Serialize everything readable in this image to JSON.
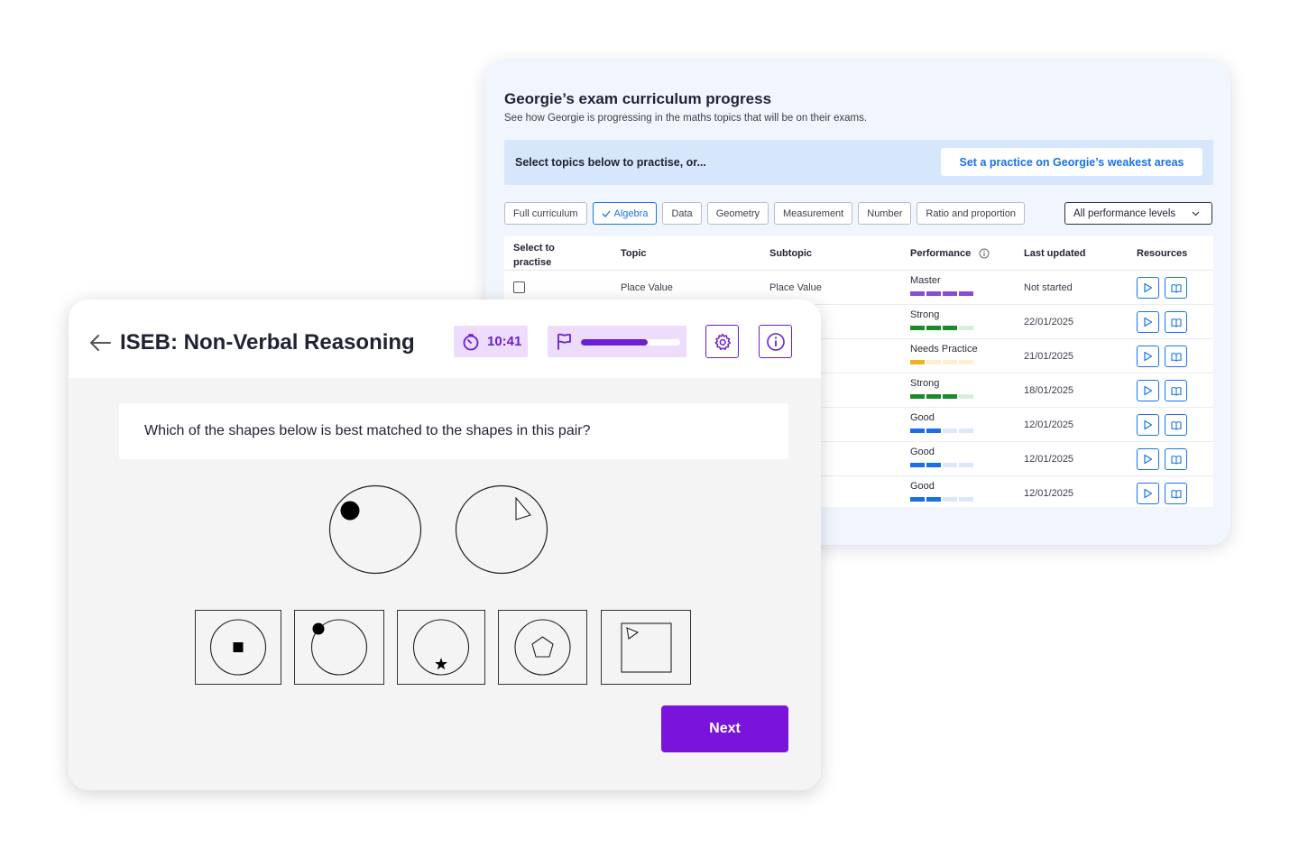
{
  "progress": {
    "title": "Georgie’s exam curriculum progress",
    "subtitle": "See how Georgie is progressing in the maths topics that will be on their exams.",
    "banner_text": "Select topics below to practise, or...",
    "banner_button": "Set a practice on Georgie’s weakest areas",
    "filters": [
      "Full curriculum",
      "Algebra",
      "Data",
      "Geometry",
      "Measurement",
      "Number",
      "Ratio and proportion"
    ],
    "active_filter": "Algebra",
    "performance_select": "All performance levels",
    "columns": {
      "select": "Select to practise",
      "topic": "Topic",
      "subtopic": "Subtopic",
      "performance": "Performance",
      "updated": "Last updated",
      "resources": "Resources"
    },
    "rows": [
      {
        "topic": "Place Value",
        "subtopic": "Place Value",
        "performance": "Master",
        "level": 4,
        "scheme": "purple",
        "updated": "Not started"
      },
      {
        "topic": "",
        "subtopic": "",
        "performance": "Strong",
        "level": 3,
        "scheme": "green",
        "updated": "22/01/2025"
      },
      {
        "topic": "",
        "subtopic": "",
        "performance": "Needs Practice",
        "level": 1,
        "scheme": "orange",
        "updated": "21/01/2025"
      },
      {
        "topic": "",
        "subtopic": "",
        "performance": "Strong",
        "level": 3,
        "scheme": "green",
        "updated": "18/01/2025"
      },
      {
        "topic": "",
        "subtopic": "",
        "performance": "Good",
        "level": 2,
        "scheme": "blue",
        "updated": "12/01/2025"
      },
      {
        "topic": "",
        "subtopic": "",
        "performance": "Good",
        "level": 2,
        "scheme": "blue",
        "updated": "12/01/2025"
      },
      {
        "topic": "",
        "subtopic": "",
        "performance": "Good",
        "level": 2,
        "scheme": "blue",
        "updated": "12/01/2025"
      }
    ],
    "colors": {
      "purple": [
        "#8a4bd6",
        "#e8dcf8"
      ],
      "green": [
        "#1a8a2a",
        "#d6efd9"
      ],
      "orange": [
        "#f2b01c",
        "#fcefd0"
      ],
      "blue": [
        "#1a6fe8",
        "#dbe8fb"
      ]
    }
  },
  "quiz": {
    "title": "ISEB: Non-Verbal Reasoning",
    "timer": "10:41",
    "progress_fraction": 0.67,
    "question": "Which of the shapes below is best matched to the shapes in this pair?",
    "next_label": "Next",
    "accent": "#7a14db"
  }
}
